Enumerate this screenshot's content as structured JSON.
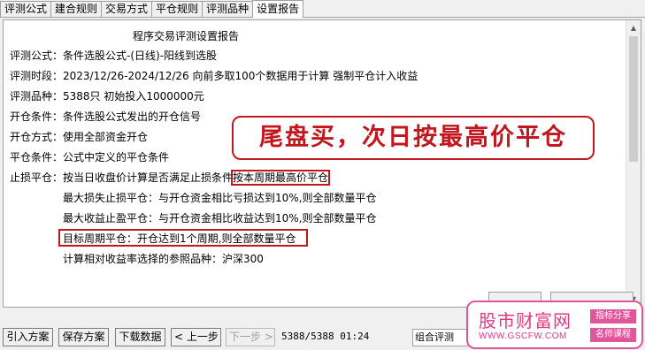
{
  "tabs": [
    {
      "label": "评测公式"
    },
    {
      "label": "建合规则"
    },
    {
      "label": "交易方式"
    },
    {
      "label": "平仓规则"
    },
    {
      "label": "评测品种"
    },
    {
      "label": "设置报告"
    }
  ],
  "report": {
    "title": "程序交易评测设置报告",
    "formula": "评测公式：条件选股公式-(日线)-阳线到选股",
    "period": "评测时段：2023/12/26-2024/12/26 向前多取100个数据用于计算 强制平仓计入收益",
    "varieties": "评测品种：5388只 初始投入1000000元",
    "open_cond": "开仓条件：条件选股公式发出的开仓信号",
    "open_method": "开仓方式：使用全部资金开仓",
    "close_cond": "平仓条件：公式中定义的平仓条件",
    "stop_prefix": "止损平仓：按当日收盘价计算是否满足止损条件",
    "stop_highlight": "按本周期最高价平仓",
    "max_loss": "最大损失止损平仓：与开仓资金相比亏损达到10%,则全部数量平仓",
    "max_profit": "最大收益止盈平仓：与开仓资金相比收益达到10%,则全部数量平仓",
    "target_period": "目标周期平仓：开仓达到1个周期,则全部数量平仓",
    "benchmark": "计算相对收益率选择的参照品种：沪深300"
  },
  "callout": {
    "text": "尾盘买，次日按最高价平仓"
  },
  "toolbar": {
    "import": "引入方案",
    "save": "保存方案",
    "download": "下载数据",
    "prev": "< 上一步",
    "next": "下一步 >",
    "status": "5388/5388 01:24",
    "combo": "组合评测"
  },
  "watermark": {
    "name": "股市财富网",
    "url": "WWW.GSCFW.COM",
    "tag1": "指标分享",
    "tag2": "名师课程"
  },
  "colors": {
    "highlight": "#c0181e",
    "watermark": "#e0569a"
  }
}
